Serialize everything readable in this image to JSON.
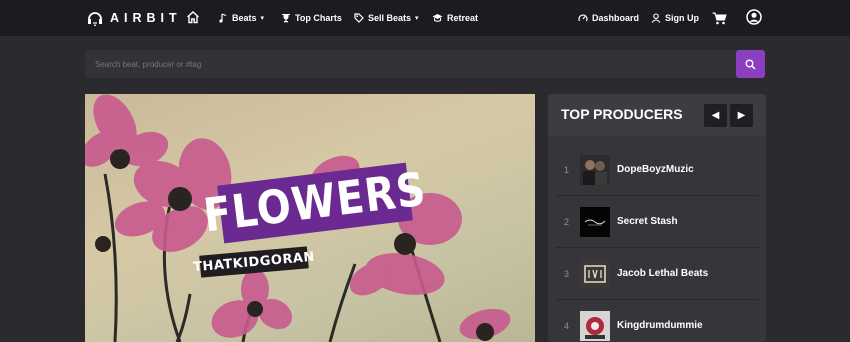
{
  "nav": {
    "logo_text": "AIRBIT",
    "items": [
      {
        "label": "Beats",
        "icon": "music-note-icon",
        "has_caret": true
      },
      {
        "label": "Top Charts",
        "icon": "trophy-icon",
        "has_caret": false
      },
      {
        "label": "Sell Beats",
        "icon": "tag-icon",
        "has_caret": true
      },
      {
        "label": "Retreat",
        "icon": "graduation-cap-icon",
        "has_caret": false
      }
    ],
    "right": [
      {
        "label": "Dashboard",
        "icon": "dashboard-icon"
      },
      {
        "label": "Sign Up",
        "icon": "user-icon"
      }
    ],
    "caret": "▾"
  },
  "search": {
    "placeholder": "Search beat, producer or #tag"
  },
  "hero": {
    "title": "FLOWERS",
    "artist": "THATKIDGORAN"
  },
  "producers": {
    "title": "TOP PRODUCERS",
    "prev": "◀",
    "next": "▶",
    "items": [
      {
        "rank": "1",
        "name": "DopeBoyzMuzic"
      },
      {
        "rank": "2",
        "name": "Secret Stash"
      },
      {
        "rank": "3",
        "name": "Jacob Lethal Beats"
      },
      {
        "rank": "4",
        "name": "Kingdrumdummie"
      }
    ]
  },
  "colors": {
    "accent": "#8a3ec0",
    "nav_bg": "#1c1b1f",
    "page_bg": "#2b2a2f",
    "title_box": "#6b2a91"
  }
}
